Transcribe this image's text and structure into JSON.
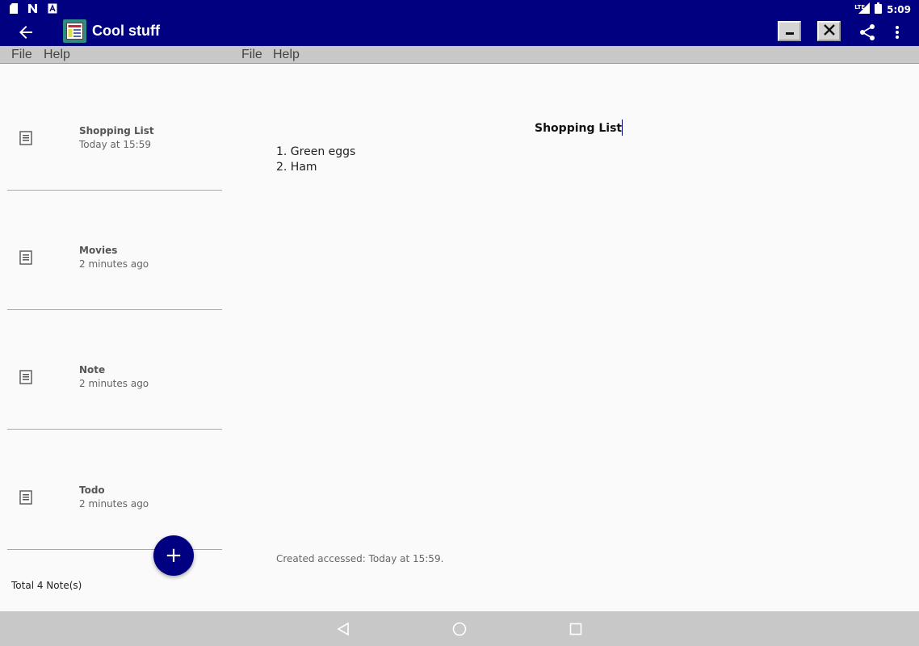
{
  "status_bar": {
    "network": "LTE",
    "time": "5:09",
    "icons": [
      "sd-card-icon",
      "n-icon",
      "a-icon",
      "signal-icon",
      "battery-icon"
    ]
  },
  "app_bar": {
    "title": "Cool stuff",
    "color": "#000080",
    "icons": [
      "back-arrow-icon",
      "app-logo-icon",
      "minimize-icon",
      "close-icon",
      "share-icon",
      "more-vert-icon"
    ]
  },
  "menus": {
    "left": [
      {
        "label": "File"
      },
      {
        "label": "Help"
      }
    ],
    "right": [
      {
        "label": "File"
      },
      {
        "label": "Help"
      }
    ]
  },
  "notes": [
    {
      "title": "Shopping List",
      "time": "Today at 15:59"
    },
    {
      "title": "Movies",
      "time": "2 minutes ago"
    },
    {
      "title": "Note",
      "time": "2 minutes ago"
    },
    {
      "title": "Todo",
      "time": "2 minutes ago"
    }
  ],
  "fab": {
    "label": "+"
  },
  "total_notes": "Total 4 Note(s)",
  "editor": {
    "title": "Shopping List",
    "lines": [
      "1. Green eggs",
      "2. Ham"
    ],
    "footer": "Created accessed: Today at 15:59."
  }
}
